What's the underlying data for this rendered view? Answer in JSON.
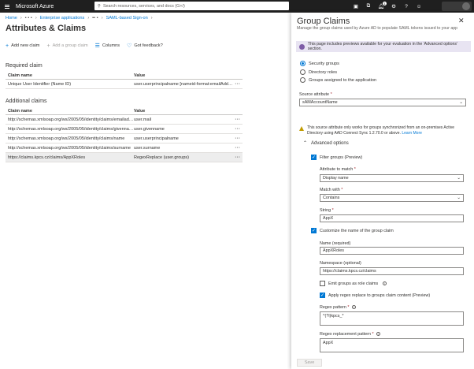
{
  "topbar": {
    "brand": "Microsoft Azure",
    "search_placeholder": "Search resources, services, and docs (G+/)",
    "notification_count": "1"
  },
  "breadcrumbs": [
    "Home",
    "Enterprise applications",
    "SAML-based Sign-on"
  ],
  "page": {
    "title": "Attributes & Claims",
    "more": "···"
  },
  "commands": {
    "add_new_claim": "Add new claim",
    "add_group_claim": "Add a group claim",
    "columns": "Columns",
    "feedback": "Got feedback?"
  },
  "required_claim": {
    "title": "Required claim",
    "headers": [
      "Claim name",
      "Value"
    ],
    "rows": [
      {
        "name": "Unique User Identifier (Name ID)",
        "value": "user.userprincipalname [nameid-format:emailAddress]"
      }
    ]
  },
  "additional_claims": {
    "title": "Additional claims",
    "headers": [
      "Claim name",
      "Value"
    ],
    "rows": [
      {
        "name": "http://schemas.xmlsoap.org/ws/2005/05/identity/claims/emailaddress",
        "value": "user.mail"
      },
      {
        "name": "http://schemas.xmlsoap.org/ws/2005/05/identity/claims/givenname",
        "value": "user.givenname"
      },
      {
        "name": "http://schemas.xmlsoap.org/ws/2005/05/identity/claims/name",
        "value": "user.userprincipalname"
      },
      {
        "name": "http://schemas.xmlsoap.org/ws/2005/05/identity/claims/surname",
        "value": "user.surname"
      },
      {
        "name": "https://claims.kpcs.cz/claims/AppXRoles",
        "value": "RegexReplace (user.groups)"
      }
    ]
  },
  "row_more": "···",
  "panel": {
    "title": "Group Claims",
    "subtitle": "Manage the group claims used by Azure AD to populate SAML tokens issued to your app",
    "preview_note": "This page includes previews available for your evaluation in the 'Advanced options' section.",
    "radios": [
      "Security groups",
      "Directory roles",
      "Groups assigned to the application"
    ],
    "source_attribute_label": "Source attribute",
    "source_attribute_value": "sAMAccountName",
    "warning": "This source attribute only works for groups synchronized from an on-premises Active Directory using AAD Connect Sync 1.2.70.0 or above.",
    "learn_more": "Learn More",
    "advanced_options": "Advanced options",
    "filter_groups": "Filter groups (Preview)",
    "attribute_to_match_label": "Attribute to match",
    "attribute_to_match_value": "Display name",
    "match_with_label": "Match with",
    "match_with_value": "Contains",
    "string_label": "String",
    "string_value": "AppX",
    "customize_name": "Customize the name of the group claim",
    "name_label": "Name (required)",
    "name_value": "AppXRoles",
    "namespace_label": "Namespace (optional)",
    "namespace_value": "https://claims.kpcs.cz/claims",
    "emit_role_claims": "Emit groups as role claims",
    "apply_regex": "Apply regex replace to groups claim content (Preview)",
    "regex_pattern_label": "Regex pattern",
    "regex_pattern_value": "^(?i)kpcs_*",
    "regex_replacement_label": "Regex replacement pattern",
    "regex_replacement_value": "AppX",
    "save": "Save"
  },
  "colors": {
    "accent": "#0078d4",
    "topbar": "#1f1f1f",
    "preview_bg": "#e8e4f2"
  }
}
